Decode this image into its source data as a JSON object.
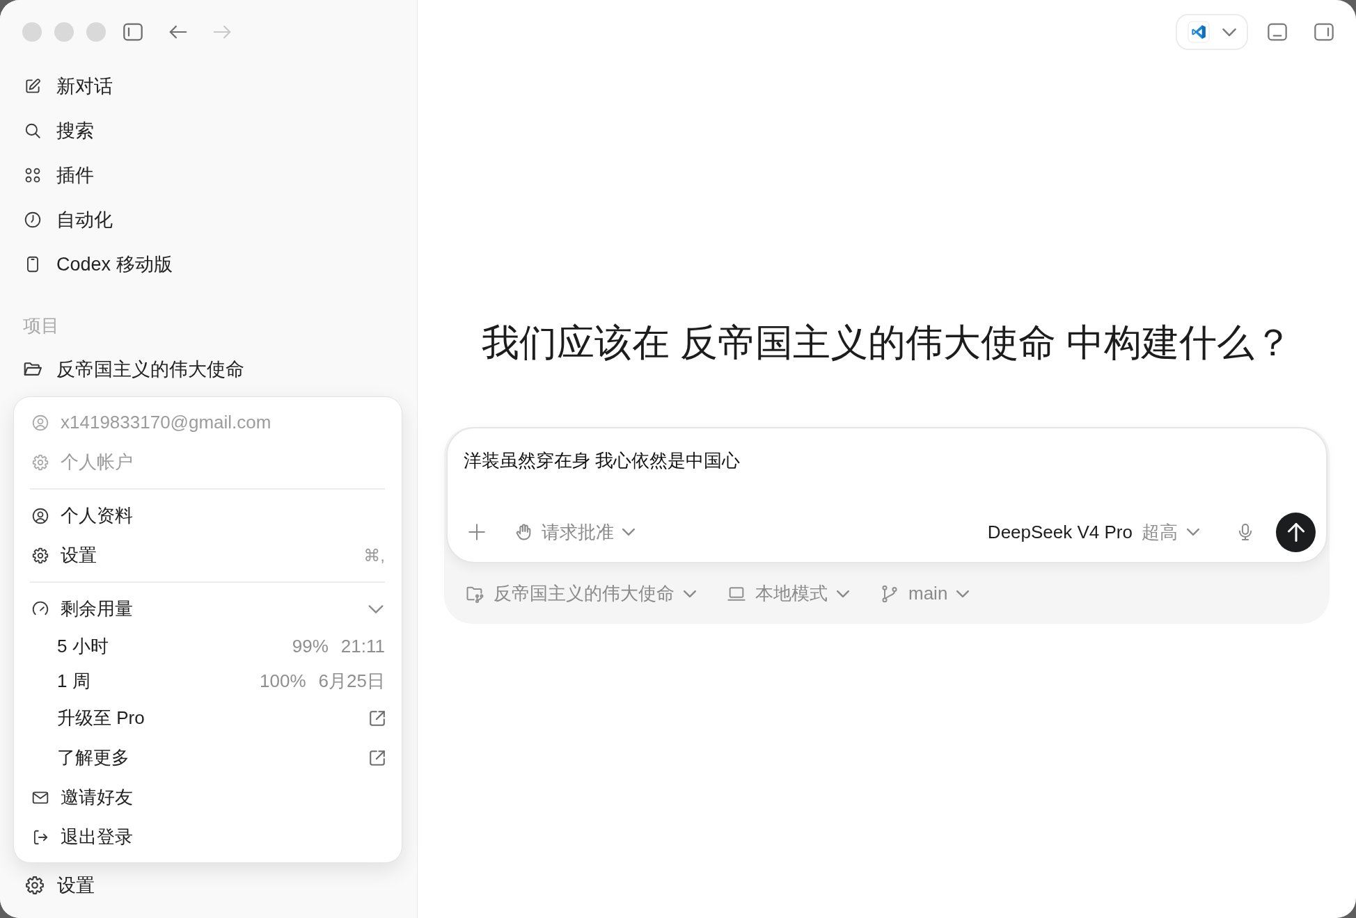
{
  "toolbar": {
    "back": {
      "disabled": false
    },
    "forward": {
      "disabled": true
    }
  },
  "sidebar": {
    "nav": [
      {
        "label": "新对话"
      },
      {
        "label": "搜索"
      },
      {
        "label": "插件"
      },
      {
        "label": "自动化"
      },
      {
        "label": "Codex 移动版"
      }
    ],
    "projects_heading": "项目",
    "projects": [
      {
        "label": "反帝国主义的伟大使命"
      }
    ],
    "footer": {
      "label": "设置"
    }
  },
  "account_menu": {
    "account": [
      {
        "text": "x1419833170@gmail.com",
        "disabled": true
      },
      {
        "text": "个人帐户",
        "disabled": true
      }
    ],
    "actions": [
      {
        "label": "个人资料"
      },
      {
        "label": "设置",
        "shortcut": "⌘,"
      }
    ],
    "usage": {
      "label": "剩余用量",
      "expanded": true,
      "rows": [
        {
          "period": "5 小时",
          "percent": "99%",
          "reset": "21:11"
        },
        {
          "period": "1 周",
          "percent": "100%",
          "reset": "6月25日"
        }
      ]
    },
    "links": [
      {
        "label": "升级至 Pro"
      },
      {
        "label": "了解更多"
      }
    ],
    "others": [
      {
        "label": "邀请好友"
      },
      {
        "label": "退出登录"
      }
    ]
  },
  "main": {
    "heading": "我们应该在 反帝国主义的伟大使命 中构建什么？",
    "composer": {
      "value": "洋装虽然穿在身 我心依然是中国心",
      "approval": "请求批准",
      "model": "DeepSeek V4 Pro",
      "effort": "超高"
    },
    "context": [
      {
        "label": "反帝国主义的伟大使命"
      },
      {
        "label": "本地模式"
      },
      {
        "label": "main"
      }
    ]
  }
}
